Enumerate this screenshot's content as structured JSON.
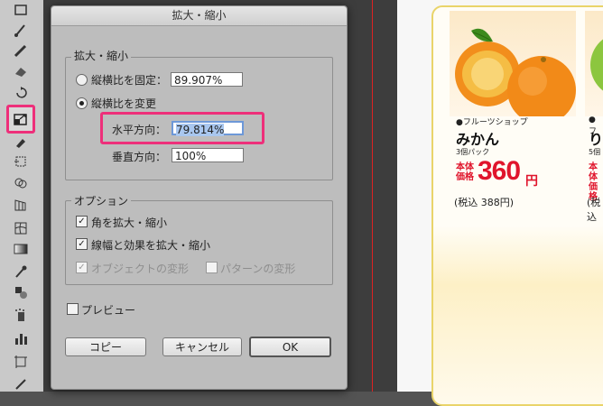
{
  "dialog": {
    "title": "拡大・縮小",
    "scale_group": {
      "legend": "拡大・縮小",
      "uniform_label": "縦横比を固定：",
      "uniform_value": "89.907%",
      "nonuniform_label": "縦横比を変更",
      "horizontal_label": "水平方向：",
      "horizontal_value": "79.814%",
      "vertical_label": "垂直方向：",
      "vertical_value": "100%"
    },
    "options_group": {
      "legend": "オプション",
      "scale_corners": "角を拡大・縮小",
      "scale_strokes": "線幅と効果を拡大・縮小",
      "transform_objects": "オブジェクトの変形",
      "transform_patterns": "パターンの変形"
    },
    "preview_label": "プレビュー",
    "buttons": {
      "copy": "コピー",
      "cancel": "キャンセル",
      "ok": "OK"
    }
  },
  "toolbar": {
    "icons": [
      "rectangle-icon",
      "paintbrush-icon",
      "pencil-icon",
      "eraser-icon",
      "rotate-icon",
      "scale-icon",
      "warp-icon",
      "free-transform-icon",
      "shape-builder-icon",
      "perspective-grid-icon",
      "mesh-icon",
      "gradient-icon",
      "eyedropper-icon",
      "blend-icon",
      "symbol-sprayer-icon",
      "column-graph-icon",
      "artboard-icon",
      "slice-icon"
    ]
  },
  "product": {
    "shop": "●フルーツショップ",
    "name": "みかん",
    "pack": "3個パック",
    "price_label_1": "本体",
    "price_label_2": "価格",
    "price": "360",
    "yen": "円",
    "tax_in": "(税込 388円)",
    "shop2": "●フ",
    "name2": "り",
    "pack2": "5個",
    "price2_label": "本体",
    "price2_label_b": "価格",
    "tax2": "(税込"
  },
  "colors": {
    "highlight": "#ee2f7a",
    "price_red": "#e0152c",
    "selection": "#a9c7ef"
  }
}
